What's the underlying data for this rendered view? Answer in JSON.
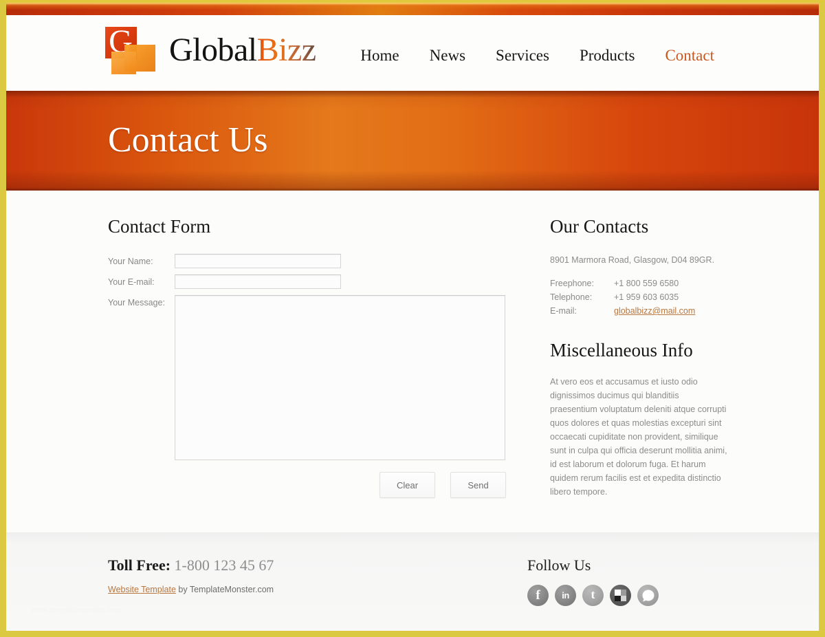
{
  "site": {
    "logo_global": "Global",
    "logo_bizz": "Bizz",
    "logo_letter": "G"
  },
  "nav": {
    "items": [
      {
        "label": "Home",
        "active": false
      },
      {
        "label": "News",
        "active": false
      },
      {
        "label": "Services",
        "active": false
      },
      {
        "label": "Products",
        "active": false
      },
      {
        "label": "Contact",
        "active": true
      }
    ]
  },
  "banner": {
    "title": "Contact Us"
  },
  "form": {
    "title": "Contact Form",
    "name_label": "Your Name:",
    "name_value": "",
    "name_placeholder": "",
    "email_label": "Your E-mail:",
    "email_value": "",
    "email_placeholder": "",
    "message_label": "Your Message:",
    "message_value": "",
    "message_placeholder": "",
    "clear_label": "Clear",
    "send_label": "Send"
  },
  "contacts": {
    "title": "Our Contacts",
    "address": "8901 Marmora Road, Glasgow, D04 89GR.",
    "rows": [
      {
        "key": "Freephone:",
        "value": "+1 800 559 6580"
      },
      {
        "key": "Telephone:",
        "value": "+1 959 603 6035"
      }
    ],
    "email_key": "E-mail:",
    "email_value": "globalbizz@mail.com"
  },
  "misc": {
    "title": "Miscellaneous Info",
    "body": "At vero eos et accusamus et iusto odio dignissimos ducimus qui blanditiis praesentium voluptatum deleniti atque corrupti quos dolores et quas molestias excepturi sint occaecati cupiditate non provident, similique sunt in culpa qui officia deserunt mollitia animi, id est laborum et dolorum fuga. Et harum quidem rerum facilis est et expedita distinctio libero tempore."
  },
  "footer": {
    "toll_label": "Toll Free:",
    "toll_number": "1-800 123 45 67",
    "credit_link": "Website Template",
    "credit_rest": " by TemplateMonster.com",
    "watermark": "www.templatemonster.com",
    "follow_title": "Follow Us",
    "social": [
      {
        "name": "facebook-icon",
        "glyph": "f"
      },
      {
        "name": "linkedin-icon",
        "glyph": "in"
      },
      {
        "name": "twitter-icon",
        "glyph": "t"
      },
      {
        "name": "delicious-icon",
        "glyph": ""
      },
      {
        "name": "comment-icon",
        "glyph": ""
      }
    ]
  },
  "colors": {
    "accent_orange": "#e2540e",
    "banner_orange": "#e5791b",
    "link_brown": "#b9763e",
    "frame_yellow": "#dbc941"
  }
}
